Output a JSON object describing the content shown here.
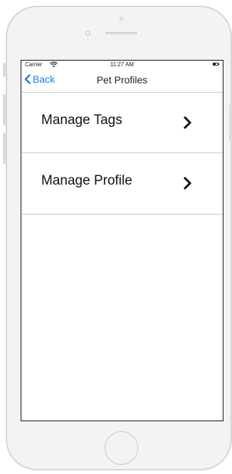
{
  "status_bar": {
    "carrier": "Carrier",
    "time": "11:27 AM",
    "wifi_icon": "wifi-icon",
    "battery_icon": "battery-icon"
  },
  "nav_bar": {
    "back_label": "Back",
    "back_icon": "chevron-left-icon",
    "title": "Pet Profiles"
  },
  "menu": {
    "items": [
      {
        "label": "Manage Tags",
        "icon": "chevron-right-icon"
      },
      {
        "label": "Manage Profile",
        "icon": "chevron-right-icon"
      }
    ]
  },
  "colors": {
    "accent": "#1a7ee8",
    "text": "#111111",
    "separator": "#c8c8c8",
    "device_frame": "#d6d6d6"
  }
}
